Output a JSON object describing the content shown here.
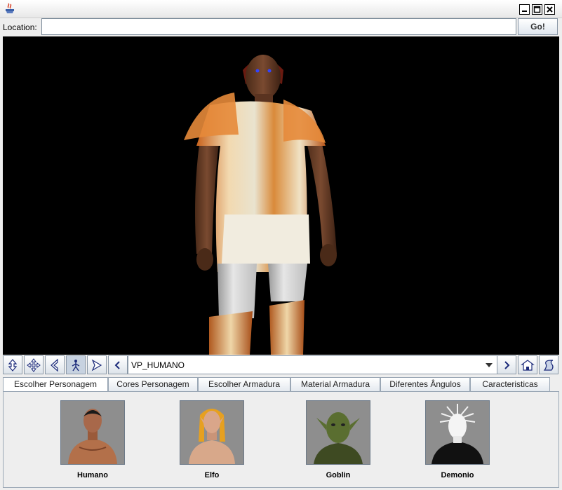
{
  "window": {
    "minimize_glyph": "minimize-icon",
    "maximize_glyph": "maximize-icon",
    "close_glyph": "close-icon"
  },
  "location": {
    "label": "Location:",
    "value": "",
    "go_label": "Go!"
  },
  "navigation": {
    "viewpoint": "VP_HUMANO",
    "buttons": [
      "walk-icon",
      "pan-icon",
      "turn-icon",
      "examine-icon",
      "fly-icon",
      "prev-viewpoint-icon",
      "next-viewpoint-icon",
      "home-icon",
      "scroll-icon"
    ]
  },
  "tabs": [
    {
      "label": "Escolher Personagem",
      "selected": true
    },
    {
      "label": "Cores Personagem",
      "selected": false
    },
    {
      "label": "Escolher Armadura",
      "selected": false
    },
    {
      "label": "Material Armadura",
      "selected": false
    },
    {
      "label": "Diferentes Ângulos",
      "selected": false
    },
    {
      "label": "Caracteristicas",
      "selected": false
    }
  ],
  "characters": [
    {
      "name": "Humano"
    },
    {
      "name": "Elfo"
    },
    {
      "name": "Goblin"
    },
    {
      "name": "Demonio"
    }
  ]
}
